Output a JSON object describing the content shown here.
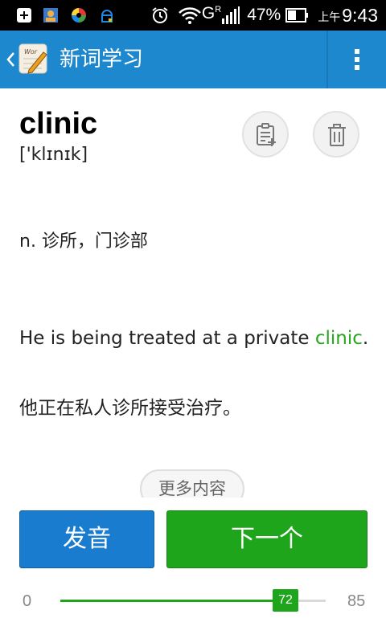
{
  "status_bar": {
    "icons": [
      "add-box-icon",
      "contacts-icon",
      "app-swirl-icon",
      "robot-icon",
      "alarm-icon",
      "wifi-icon",
      "signal-icon",
      "battery-icon"
    ],
    "network_label": "G",
    "network_sup": "R",
    "battery_percent": "47%",
    "ampm": "上午",
    "time": "9:43"
  },
  "app_bar": {
    "title": "新词学习",
    "back_icon": "chevron-left-icon",
    "app_icon": "notebook-pencil-icon",
    "overflow_icon": "more-vert-icon"
  },
  "word": {
    "text": "clinic",
    "phonetic": "['klɪnɪk]"
  },
  "actions": {
    "add_icon": "add-to-list-icon",
    "delete_icon": "trash-icon"
  },
  "definition": "n. 诊所，门诊部",
  "example": {
    "en_before": "He is being treated at a private ",
    "highlight": "clinic",
    "en_after": ".",
    "zh": "他正在私人诊所接受治疗。"
  },
  "more_button": "更多内容",
  "buttons": {
    "pronounce": "发音",
    "next": "下一个"
  },
  "progress": {
    "min": "0",
    "max": "85",
    "current": "72",
    "current_value": 72,
    "max_value": 85
  },
  "colors": {
    "app_bar": "#1e88cf",
    "accent_green": "#1fa51c",
    "pronounce_blue": "#1a7ccf"
  }
}
